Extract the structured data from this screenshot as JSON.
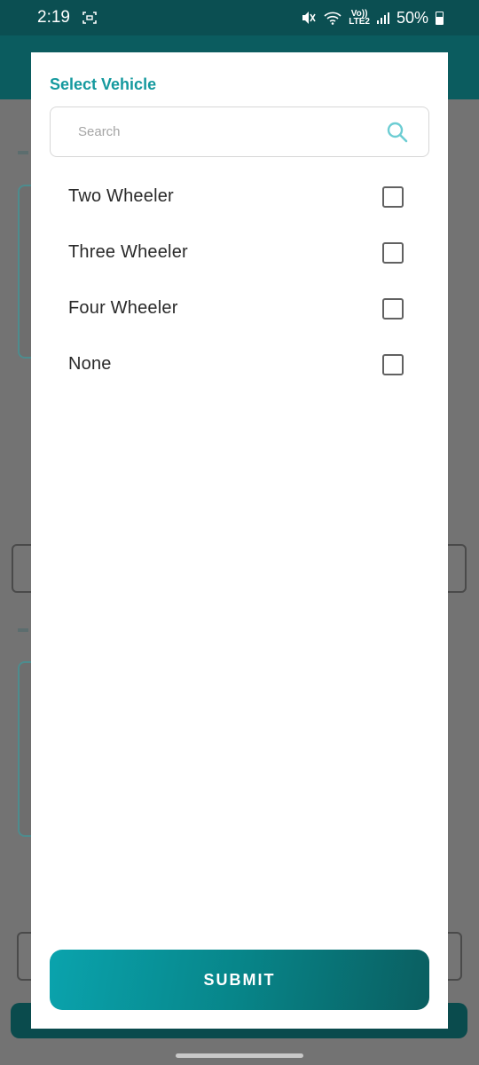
{
  "status_bar": {
    "time": "2:19",
    "network_label_top": "Vo))",
    "network_label_bottom": "LTE2",
    "battery_percent": "50%"
  },
  "dialog": {
    "title": "Select Vehicle",
    "search": {
      "placeholder": "Search",
      "value": ""
    },
    "options": [
      {
        "label": "Two Wheeler",
        "checked": false
      },
      {
        "label": "Three Wheeler",
        "checked": false
      },
      {
        "label": "Four Wheeler",
        "checked": false
      },
      {
        "label": "None",
        "checked": false
      }
    ],
    "submit_label": "SUBMIT"
  },
  "colors": {
    "accent": "#14999e",
    "status_bar_bg": "#0b4f52",
    "button_gradient_start": "#0aa3ad",
    "button_gradient_end": "#0a5e60"
  }
}
